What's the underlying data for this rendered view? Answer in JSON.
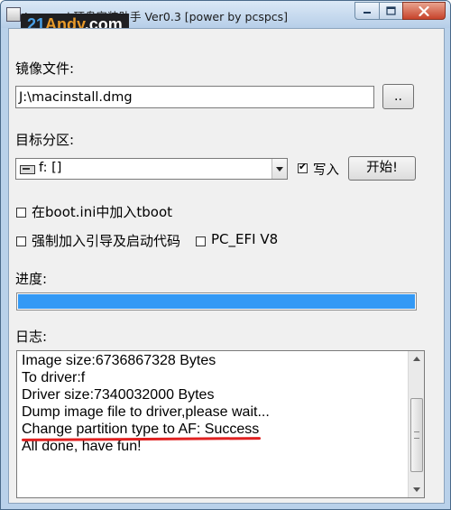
{
  "window": {
    "title": "Leopard 硬盘安装助手 Ver0.3 [power by pcspcs]",
    "watermark": {
      "num": "21",
      "brand": "Andy",
      "tld": ".com"
    }
  },
  "image_file": {
    "label": "镜像文件:",
    "path": "J:\\macinstall.dmg",
    "browse_button": ".."
  },
  "target_partition": {
    "label": "目标分区:",
    "selected": "f: []",
    "write_checkbox": {
      "label": "写入",
      "checked": true
    },
    "start_button": "开始!"
  },
  "options": {
    "boot_ini": {
      "label": "在boot.ini中加入tboot",
      "checked": false
    },
    "force_boot": {
      "label": "强制加入引导及启动代码",
      "checked": false
    },
    "pc_efi": {
      "label": "PC_EFI V8",
      "checked": false
    }
  },
  "progress": {
    "label": "进度:",
    "value": 1.0
  },
  "log": {
    "label": "日志:",
    "lines": [
      "Image size:6736867328 Bytes",
      "To driver:f",
      "Driver size:7340032000 Bytes",
      "Dump image file to driver,please wait...",
      "Change partition type to AF: Success",
      "All done, have fun!"
    ]
  },
  "colors": {
    "progress_fill": "#3399f5",
    "highlight_underline": "#e02020"
  },
  "icons": {
    "app": "app-icon",
    "minimize": "minimize-icon",
    "maximize": "maximize-icon",
    "close": "close-icon",
    "drive": "drive-icon"
  }
}
